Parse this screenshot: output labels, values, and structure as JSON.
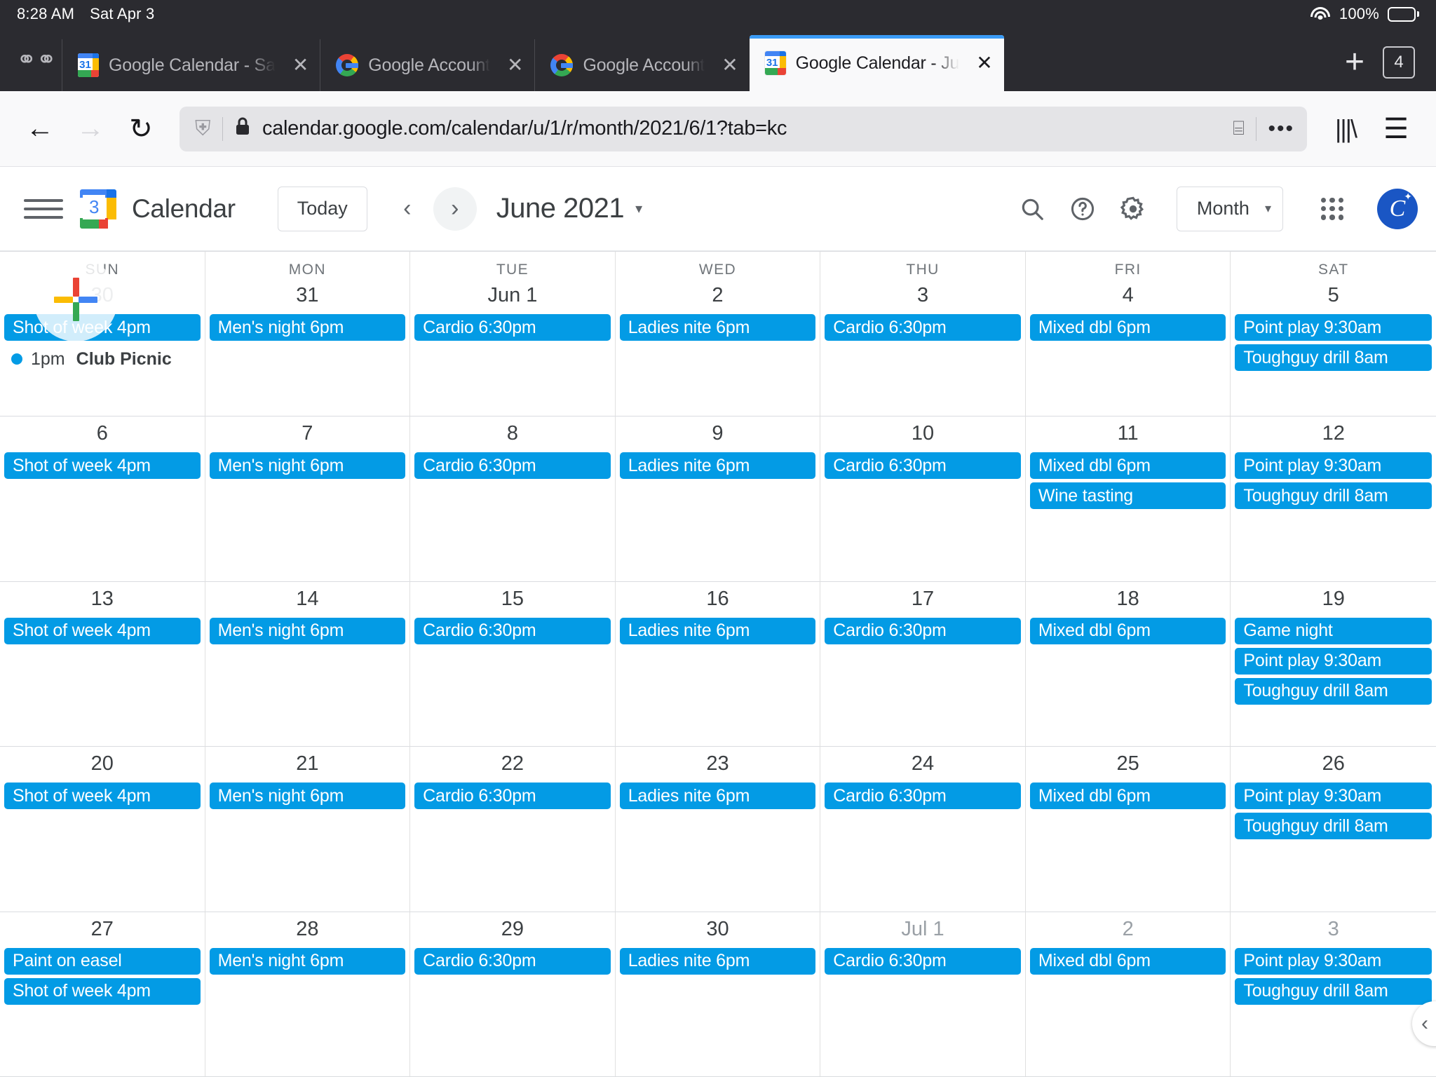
{
  "status_bar": {
    "time": "8:28 AM",
    "date": "Sat Apr 3",
    "battery_percent": "100%",
    "wifi_icon": "wifi-icon",
    "battery_icon": "battery-icon"
  },
  "browser": {
    "private_mask_icon": "mask-icon",
    "tabs": [
      {
        "title": "Google Calendar - Sa",
        "favicon": "google-calendar-favicon",
        "favicon_number": "31",
        "active": false,
        "close_label": "✕"
      },
      {
        "title": "Google Account",
        "favicon": "google-favicon",
        "active": false,
        "close_label": "✕"
      },
      {
        "title": "Google Account",
        "favicon": "google-favicon",
        "active": false,
        "close_label": "✕"
      },
      {
        "title": "Google Calendar - Ju",
        "favicon": "google-calendar-favicon",
        "favicon_number": "31",
        "active": true,
        "close_label": "✕"
      }
    ],
    "new_tab_label": "+",
    "tab_count": "4",
    "toolbar": {
      "back_label": "←",
      "forward_label": "→",
      "reload_label": "↻",
      "shield_label": "⛨",
      "lock_label": "🔒",
      "url": "calendar.google.com/calendar/u/1/r/month/2021/6/1?tab=kc",
      "reader_label": "⌸",
      "more_label": "•••",
      "library_label": "library-icon",
      "menu_label": "☰"
    }
  },
  "app_header": {
    "menu_label": "main-menu",
    "logo_number": "3",
    "title": "Calendar",
    "today_label": "Today",
    "prev_label": "‹",
    "next_label": "›",
    "current_period": "June 2021",
    "period_caret": "▾",
    "search_label": "search",
    "help_label": "?",
    "settings_label": "settings",
    "view_value": "Month",
    "view_caret": "▾",
    "apps_label": "google-apps",
    "avatar_initial": "C"
  },
  "calendar": {
    "day_headers": [
      "SUN",
      "MON",
      "TUE",
      "WED",
      "THU",
      "FRI",
      "SAT"
    ],
    "accent_color": "#039be5",
    "weeks": [
      {
        "days": [
          {
            "num": "30",
            "muted": true,
            "events": [
              {
                "text": "Shot of week 4pm",
                "type": "chip"
              },
              {
                "text": "Club Picnic",
                "time": "1pm",
                "type": "dot"
              }
            ]
          },
          {
            "num": "31",
            "muted": false,
            "events": [
              {
                "text": "Men's night 6pm",
                "type": "chip"
              }
            ]
          },
          {
            "num": "Jun 1",
            "muted": false,
            "events": [
              {
                "text": "Cardio 6:30pm",
                "type": "chip"
              }
            ]
          },
          {
            "num": "2",
            "muted": false,
            "events": [
              {
                "text": "Ladies nite 6pm",
                "type": "chip"
              }
            ]
          },
          {
            "num": "3",
            "muted": false,
            "events": [
              {
                "text": "Cardio 6:30pm",
                "type": "chip"
              }
            ]
          },
          {
            "num": "4",
            "muted": false,
            "events": [
              {
                "text": "Mixed dbl 6pm",
                "type": "chip"
              }
            ]
          },
          {
            "num": "5",
            "muted": false,
            "events": [
              {
                "text": "Point play 9:30am",
                "type": "chip"
              },
              {
                "text": "Toughguy drill 8am",
                "type": "chip"
              }
            ]
          }
        ]
      },
      {
        "days": [
          {
            "num": "6",
            "muted": false,
            "events": [
              {
                "text": "Shot of week 4pm",
                "type": "chip"
              }
            ]
          },
          {
            "num": "7",
            "muted": false,
            "events": [
              {
                "text": "Men's night 6pm",
                "type": "chip"
              }
            ]
          },
          {
            "num": "8",
            "muted": false,
            "events": [
              {
                "text": "Cardio 6:30pm",
                "type": "chip"
              }
            ]
          },
          {
            "num": "9",
            "muted": false,
            "events": [
              {
                "text": "Ladies nite 6pm",
                "type": "chip"
              }
            ]
          },
          {
            "num": "10",
            "muted": false,
            "events": [
              {
                "text": "Cardio 6:30pm",
                "type": "chip"
              }
            ]
          },
          {
            "num": "11",
            "muted": false,
            "events": [
              {
                "text": "Mixed dbl 6pm",
                "type": "chip"
              },
              {
                "text": "Wine tasting",
                "type": "chip"
              }
            ]
          },
          {
            "num": "12",
            "muted": false,
            "events": [
              {
                "text": "Point play 9:30am",
                "type": "chip"
              },
              {
                "text": "Toughguy drill 8am",
                "type": "chip"
              }
            ]
          }
        ]
      },
      {
        "days": [
          {
            "num": "13",
            "muted": false,
            "events": [
              {
                "text": "Shot of week 4pm",
                "type": "chip"
              }
            ]
          },
          {
            "num": "14",
            "muted": false,
            "events": [
              {
                "text": "Men's night 6pm",
                "type": "chip"
              }
            ]
          },
          {
            "num": "15",
            "muted": false,
            "events": [
              {
                "text": "Cardio 6:30pm",
                "type": "chip"
              }
            ]
          },
          {
            "num": "16",
            "muted": false,
            "events": [
              {
                "text": "Ladies nite 6pm",
                "type": "chip"
              }
            ]
          },
          {
            "num": "17",
            "muted": false,
            "events": [
              {
                "text": "Cardio 6:30pm",
                "type": "chip"
              }
            ]
          },
          {
            "num": "18",
            "muted": false,
            "events": [
              {
                "text": "Mixed dbl 6pm",
                "type": "chip"
              }
            ]
          },
          {
            "num": "19",
            "muted": false,
            "events": [
              {
                "text": "Game night",
                "type": "chip"
              },
              {
                "text": "Point play 9:30am",
                "type": "chip"
              },
              {
                "text": "Toughguy drill 8am",
                "type": "chip"
              }
            ]
          }
        ]
      },
      {
        "days": [
          {
            "num": "20",
            "muted": false,
            "events": [
              {
                "text": "Shot of week 4pm",
                "type": "chip"
              }
            ]
          },
          {
            "num": "21",
            "muted": false,
            "events": [
              {
                "text": "Men's night 6pm",
                "type": "chip"
              }
            ]
          },
          {
            "num": "22",
            "muted": false,
            "events": [
              {
                "text": "Cardio 6:30pm",
                "type": "chip"
              }
            ]
          },
          {
            "num": "23",
            "muted": false,
            "events": [
              {
                "text": "Ladies nite 6pm",
                "type": "chip"
              }
            ]
          },
          {
            "num": "24",
            "muted": false,
            "events": [
              {
                "text": "Cardio 6:30pm",
                "type": "chip"
              }
            ]
          },
          {
            "num": "25",
            "muted": false,
            "events": [
              {
                "text": "Mixed dbl 6pm",
                "type": "chip"
              }
            ]
          },
          {
            "num": "26",
            "muted": false,
            "events": [
              {
                "text": "Point play 9:30am",
                "type": "chip"
              },
              {
                "text": "Toughguy drill 8am",
                "type": "chip"
              }
            ]
          }
        ]
      },
      {
        "days": [
          {
            "num": "27",
            "muted": false,
            "events": [
              {
                "text": "Paint on easel",
                "type": "chip"
              },
              {
                "text": "Shot of week 4pm",
                "type": "chip"
              }
            ]
          },
          {
            "num": "28",
            "muted": false,
            "events": [
              {
                "text": "Men's night 6pm",
                "type": "chip"
              }
            ]
          },
          {
            "num": "29",
            "muted": false,
            "events": [
              {
                "text": "Cardio 6:30pm",
                "type": "chip"
              }
            ]
          },
          {
            "num": "30",
            "muted": false,
            "events": [
              {
                "text": "Ladies nite 6pm",
                "type": "chip"
              }
            ]
          },
          {
            "num": "Jul 1",
            "muted": true,
            "events": [
              {
                "text": "Cardio 6:30pm",
                "type": "chip"
              }
            ]
          },
          {
            "num": "2",
            "muted": true,
            "events": [
              {
                "text": "Mixed dbl 6pm",
                "type": "chip"
              }
            ]
          },
          {
            "num": "3",
            "muted": true,
            "events": [
              {
                "text": "Point play 9:30am",
                "type": "chip"
              },
              {
                "text": "Toughguy drill 8am",
                "type": "chip"
              }
            ]
          }
        ]
      }
    ],
    "create_button_label": "create-event",
    "collapse_handle_label": "‹"
  }
}
